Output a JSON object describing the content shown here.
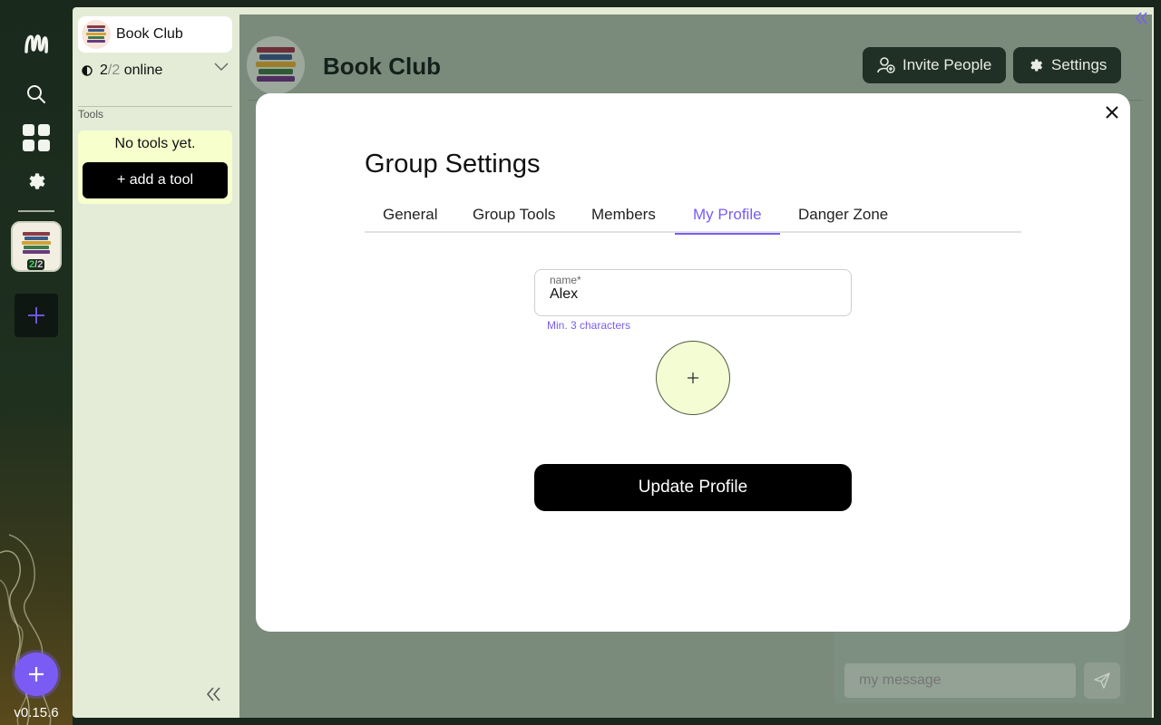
{
  "app": {
    "version": "v0.15.6",
    "colors": {
      "accent": "#7a5cf5",
      "online": "#46d25b",
      "sidebar_bg": "#e4ecd7",
      "tools_bg": "#f7ffcd"
    }
  },
  "rail": {
    "icons": [
      "app-logo-icon",
      "search-icon",
      "grid-icon",
      "gear-icon",
      "plus-icon"
    ],
    "group": {
      "online": "2",
      "separator": "/",
      "total": "2"
    }
  },
  "sidebar": {
    "group_name": "Book Club",
    "online_count": "2",
    "online_sep": "/",
    "online_total": "2",
    "online_label": "online",
    "tools_label": "Tools",
    "tools_empty": "No tools yet.",
    "add_tool_label": "+ add a tool"
  },
  "main": {
    "title": "Book Club",
    "invite_label": "Invite People",
    "settings_label": "Settings",
    "message_placeholder": "my message"
  },
  "modal": {
    "title": "Group Settings",
    "tabs": [
      {
        "label": "General",
        "active": false
      },
      {
        "label": "Group Tools",
        "active": false
      },
      {
        "label": "Members",
        "active": false
      },
      {
        "label": "My Profile",
        "active": true
      },
      {
        "label": "Danger Zone",
        "active": false
      }
    ],
    "name_label": "name*",
    "name_value": "Alex",
    "name_hint": "Min. 3 characters",
    "submit_label": "Update Profile"
  }
}
